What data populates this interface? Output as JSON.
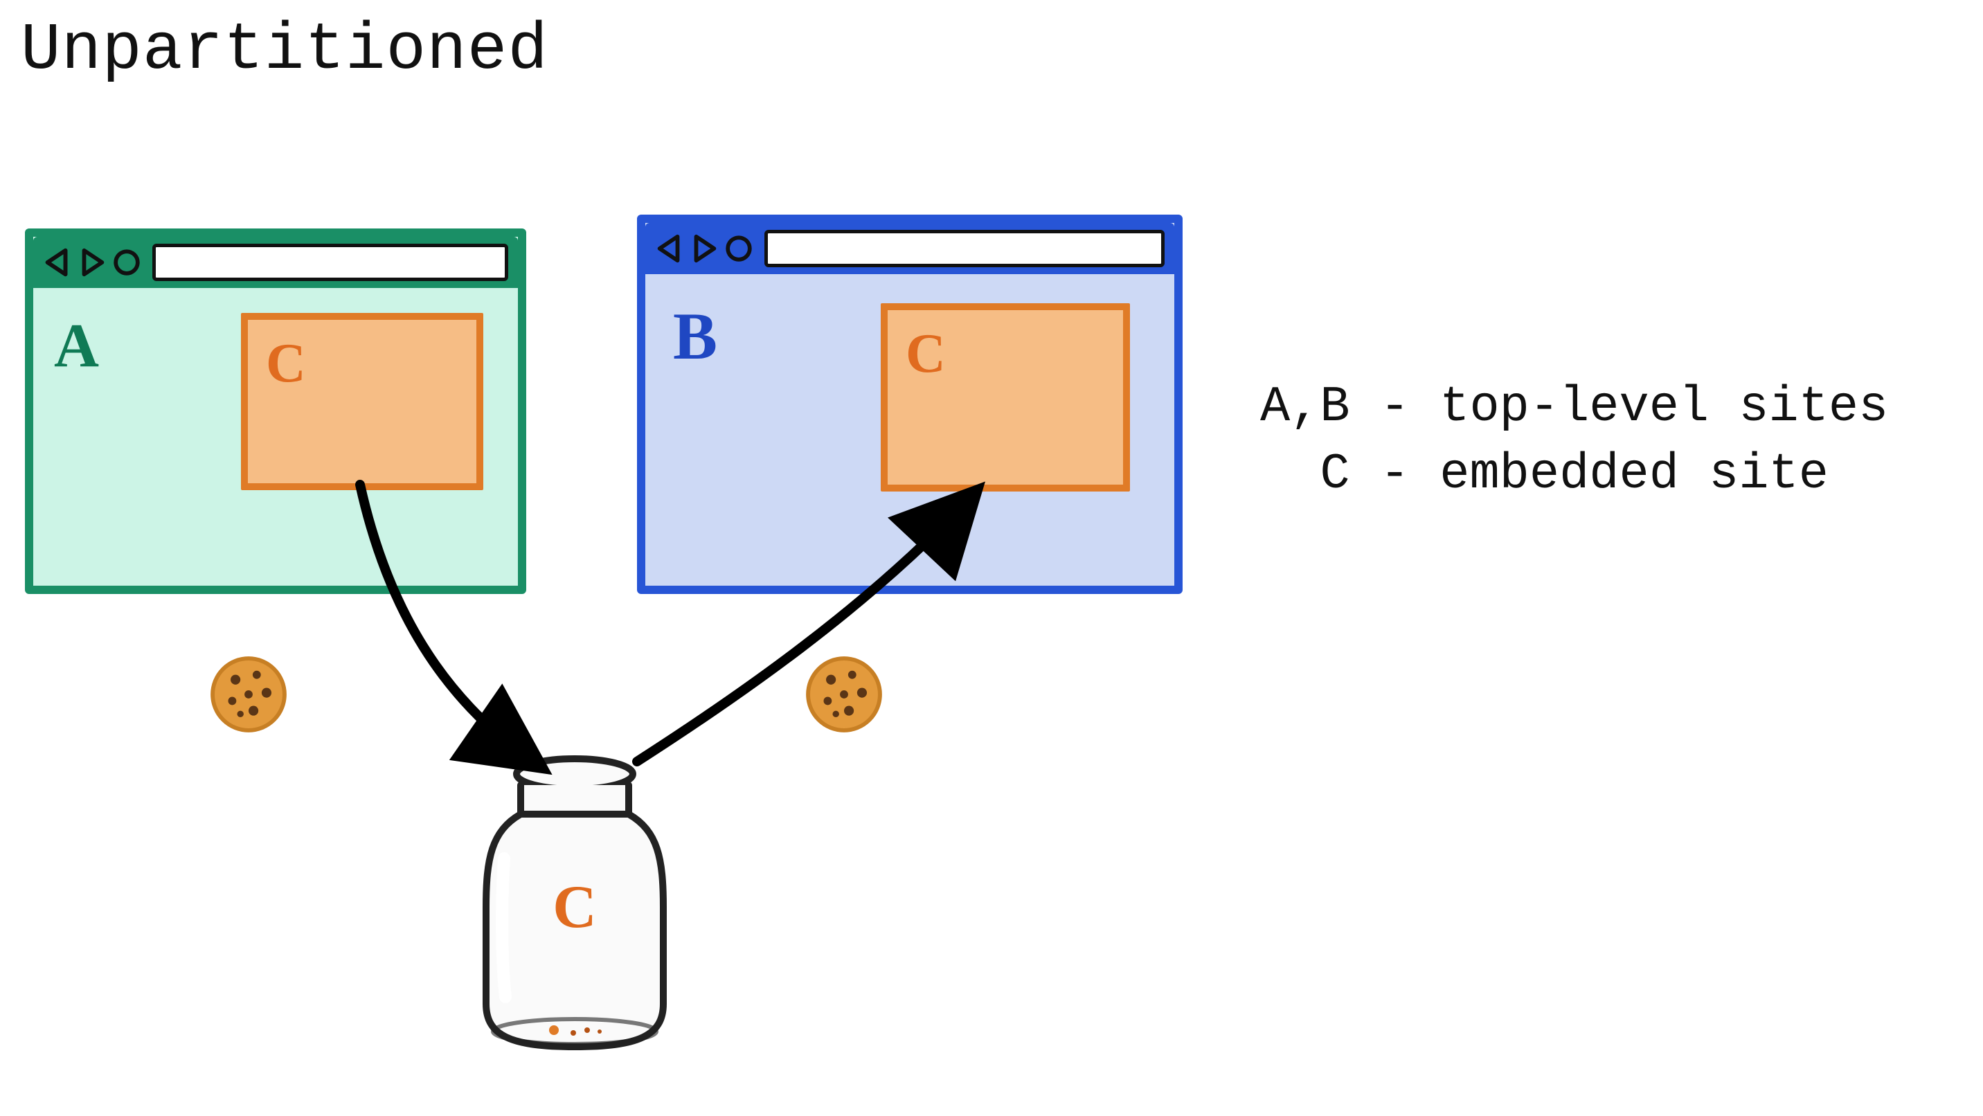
{
  "title": "Unpartitioned",
  "legend": {
    "line1": "A,B - top-level sites",
    "line2": "  C - embedded site"
  },
  "windows": {
    "a": {
      "site_label": "A",
      "embed_label": "C"
    },
    "b": {
      "site_label": "B",
      "embed_label": "C"
    }
  },
  "jar": {
    "label": "C"
  },
  "cookies": {
    "left_hint": "cookie",
    "right_hint": "cookie"
  },
  "icons": {
    "back": "back-icon",
    "forward": "forward-icon",
    "reload": "reload-icon"
  },
  "colors": {
    "site_a": "#1a8f66",
    "site_a_fill": "#ccf4e6",
    "site_b": "#2755d6",
    "site_b_fill": "#cdd9f5",
    "embed_border": "#e07b27",
    "embed_fill": "#f6bd85",
    "embed_text": "#e06b1f",
    "arrow": "#000000",
    "cookie_base": "#e39a3c",
    "cookie_edge": "#c77f24",
    "chip": "#5a3516"
  }
}
